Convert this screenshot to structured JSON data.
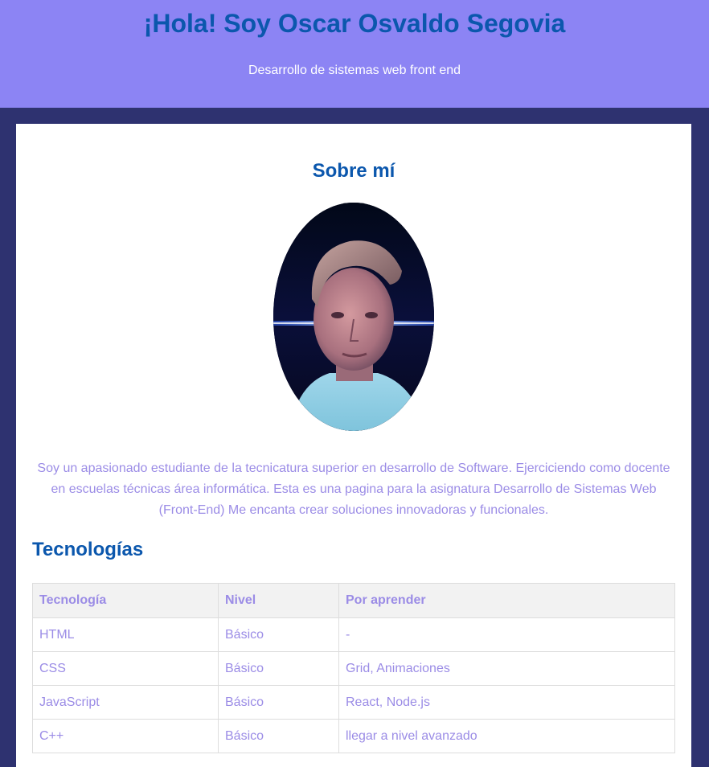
{
  "header": {
    "title": "¡Hola! Soy Oscar Osvaldo Segovia",
    "subtitle": "Desarrollo de sistemas web front end"
  },
  "about": {
    "heading": "Sobre mí",
    "photo_icon": "profile-photo",
    "text": "Soy un apasionado estudiante de la tecnicatura superior en desarrollo de Software. Ejerciciendo como docente en escuelas técnicas área informática. Esta es una pagina para la asignatura Desarrollo de Sistemas Web (Front-End) Me encanta crear soluciones innovadoras y funcionales."
  },
  "technologies": {
    "heading": "Tecnologías",
    "columns": [
      "Tecnología",
      "Nivel",
      "Por aprender"
    ],
    "rows": [
      [
        "HTML",
        "Básico",
        "-"
      ],
      [
        "CSS",
        "Básico",
        "Grid, Animaciones"
      ],
      [
        "JavaScript",
        "Básico",
        "React, Node.js"
      ],
      [
        "C++",
        "Básico",
        "llegar a nivel avanzado"
      ]
    ]
  },
  "colors": {
    "header_bg": "#8c84f4",
    "page_bg": "#2e3270",
    "title": "#0b57ad",
    "text": "#9b8ce6"
  }
}
